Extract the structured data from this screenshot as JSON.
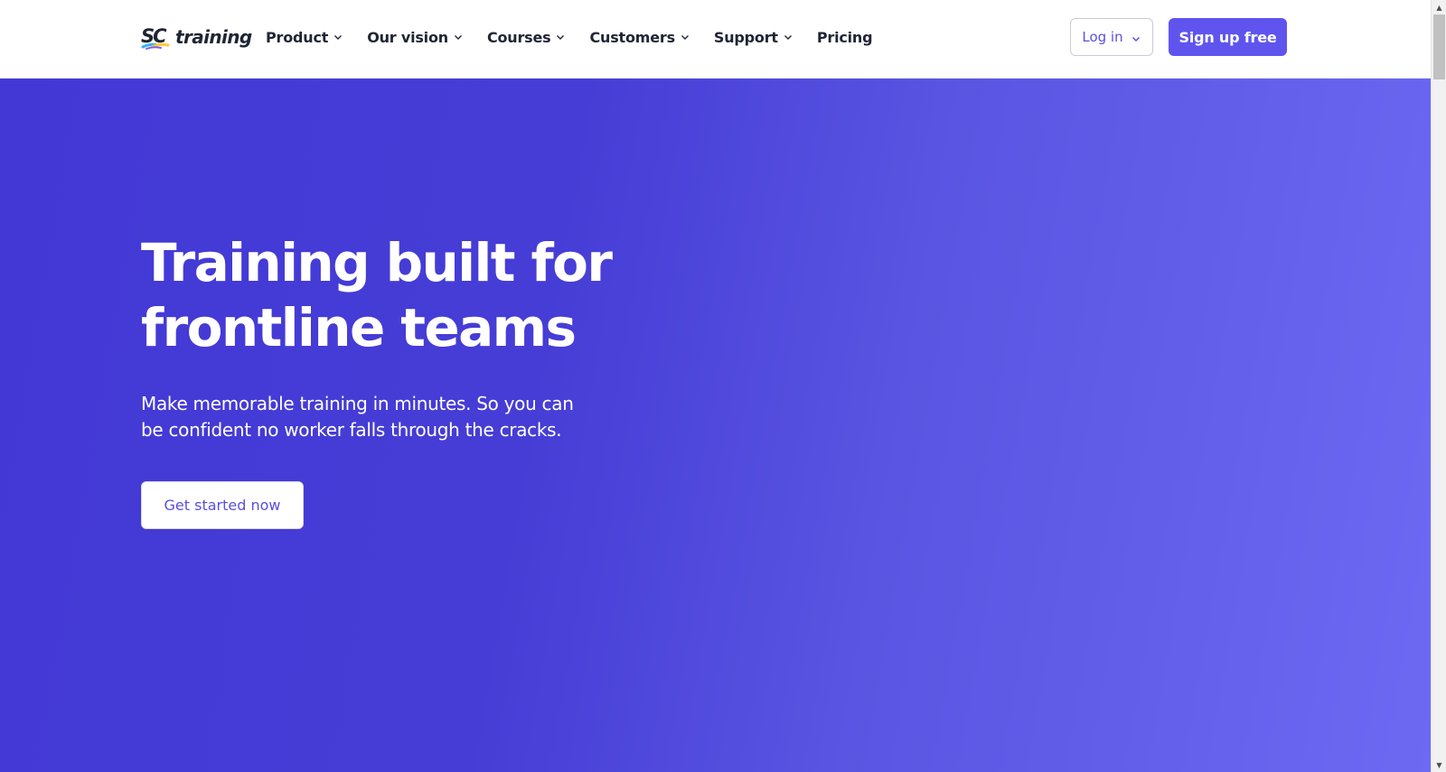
{
  "header": {
    "logo": {
      "mark": "SC",
      "text": "training"
    },
    "nav": [
      {
        "label": "Product",
        "has_dropdown": true
      },
      {
        "label": "Our vision",
        "has_dropdown": true
      },
      {
        "label": "Courses",
        "has_dropdown": true
      },
      {
        "label": "Customers",
        "has_dropdown": true
      },
      {
        "label": "Support",
        "has_dropdown": true
      },
      {
        "label": "Pricing",
        "has_dropdown": false
      }
    ],
    "login_label": "Log in",
    "signup_label": "Sign up free"
  },
  "hero": {
    "title": "Training built for frontline teams",
    "subtitle": "Make memorable training in minutes. So you can be confident no worker falls through the cracks.",
    "cta_label": "Get started now"
  },
  "colors": {
    "brand": "#5f55ee",
    "hero_gradient_start": "#4338d6",
    "hero_gradient_end": "#6d69f3",
    "nav_text": "#1f2533",
    "link_text": "#5b4fe0"
  },
  "icons": {
    "dropdown": "chevron-down-icon",
    "scroll_up": "arrow-up-icon",
    "scroll_down": "arrow-down-icon"
  }
}
